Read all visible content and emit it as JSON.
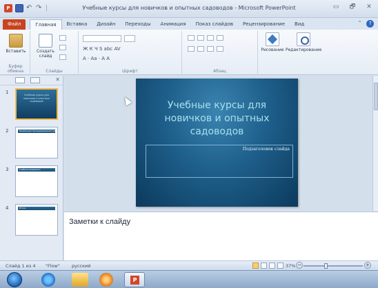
{
  "window": {
    "title": "Учебные курсы для новичков и опытных садоводов - Microsoft PowerPoint",
    "controls": [
      "▭",
      "🗗",
      "✕"
    ]
  },
  "qat": {
    "app_icon": "P",
    "separator": "|"
  },
  "tabs": [
    {
      "label": "Файл"
    },
    {
      "label": "Главная"
    },
    {
      "label": "Вставка"
    },
    {
      "label": "Дизайн"
    },
    {
      "label": "Переходы"
    },
    {
      "label": "Анимация"
    },
    {
      "label": "Показ слайдов"
    },
    {
      "label": "Рецензирование"
    },
    {
      "label": "Вид"
    }
  ],
  "ribbon": {
    "paste_label": "Вставить",
    "new_slide_label": "Создать слайд",
    "drawing_label": "Рисование",
    "editing_label": "Редактирование",
    "groups": {
      "clipboard": "Буфер обмена",
      "slides": "Слайды",
      "font": "Шрифт",
      "paragraph": "Абзац"
    },
    "font_buttons": "Ж  К  Ч  S  abc  AV",
    "font_size_buttons": "A · Aa ·  A  A"
  },
  "slides_panel": {
    "thumbs": [
      {
        "num": "1",
        "text": "Учебные курсы для новичков и опытных садоводов"
      },
      {
        "num": "2",
        "text": "Преимущества выращивания садов"
      },
      {
        "num": "3",
        "text": "Учебные предметы"
      },
      {
        "num": "4",
        "text": "Итоги"
      }
    ]
  },
  "slide": {
    "title": "Учебные курсы для новичков и опытных садоводов",
    "subtitle_placeholder": "Подзаголовок слайда"
  },
  "notes": {
    "placeholder": "Заметки к слайду"
  },
  "statusbar": {
    "slide_counter": "Слайд 1 из 4",
    "theme": "\"Flow\"",
    "language": "русский",
    "zoom": "37%",
    "zoom_minus": "−",
    "zoom_plus": "+"
  },
  "colors": {
    "file_tab": "#c8431f",
    "slide_title": "#a7e0ee",
    "selected_thumb_border": "#f2b84a"
  }
}
